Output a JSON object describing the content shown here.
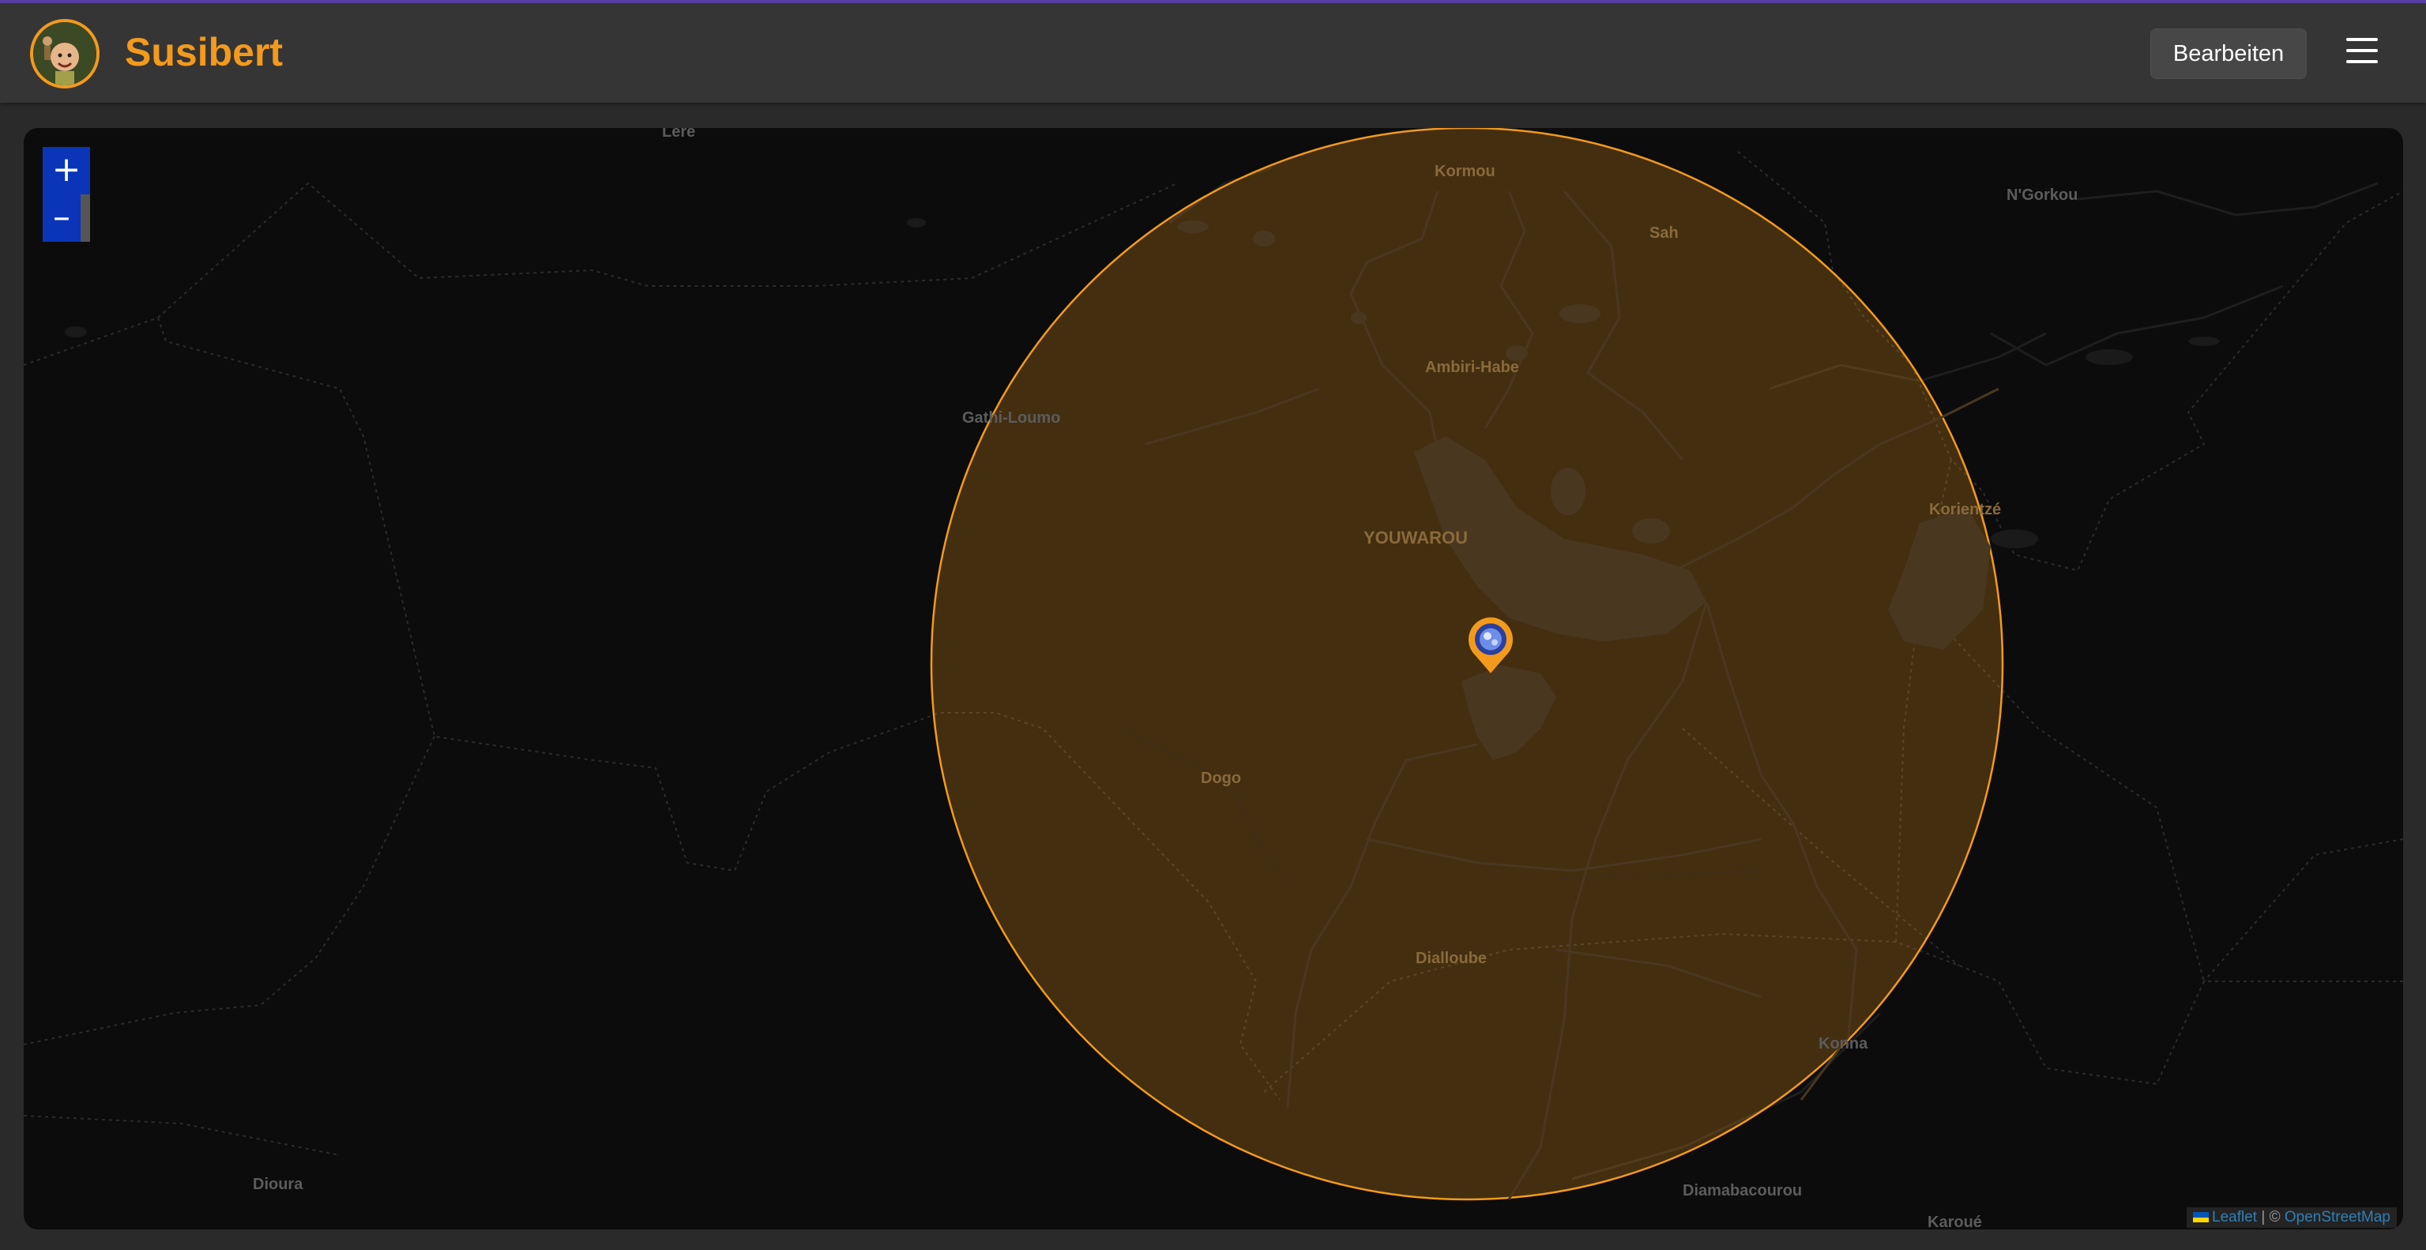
{
  "header": {
    "title": "Susibert",
    "edit_label": "Bearbeiten",
    "menu_icon": "hamburger-menu-icon",
    "accent_color": "#f39a1c"
  },
  "map": {
    "zoom_in_label": "+",
    "zoom_out_label": "–",
    "radius_circle_color": "#f39a1c",
    "place_labels": {
      "lere": "Léré",
      "kormou": "Kormou",
      "ngorkou": "N'Gorkou",
      "sah": "Sah",
      "ambiri_habe": "Ambiri-Habe",
      "gathi_loumo": "Gathi-Loumo",
      "korientze": "Korientzé",
      "youwarou": "YOUWAROU",
      "dogo": "Dogo",
      "dialloube": "Dialloube",
      "konna": "Konna",
      "dioura": "Dioura",
      "diamabacourou": "Diamabacourou",
      "karoue": "Karoué"
    },
    "attribution": {
      "leaflet": "Leaflet",
      "separator": "| ©",
      "osm": "OpenStreetMap"
    }
  }
}
